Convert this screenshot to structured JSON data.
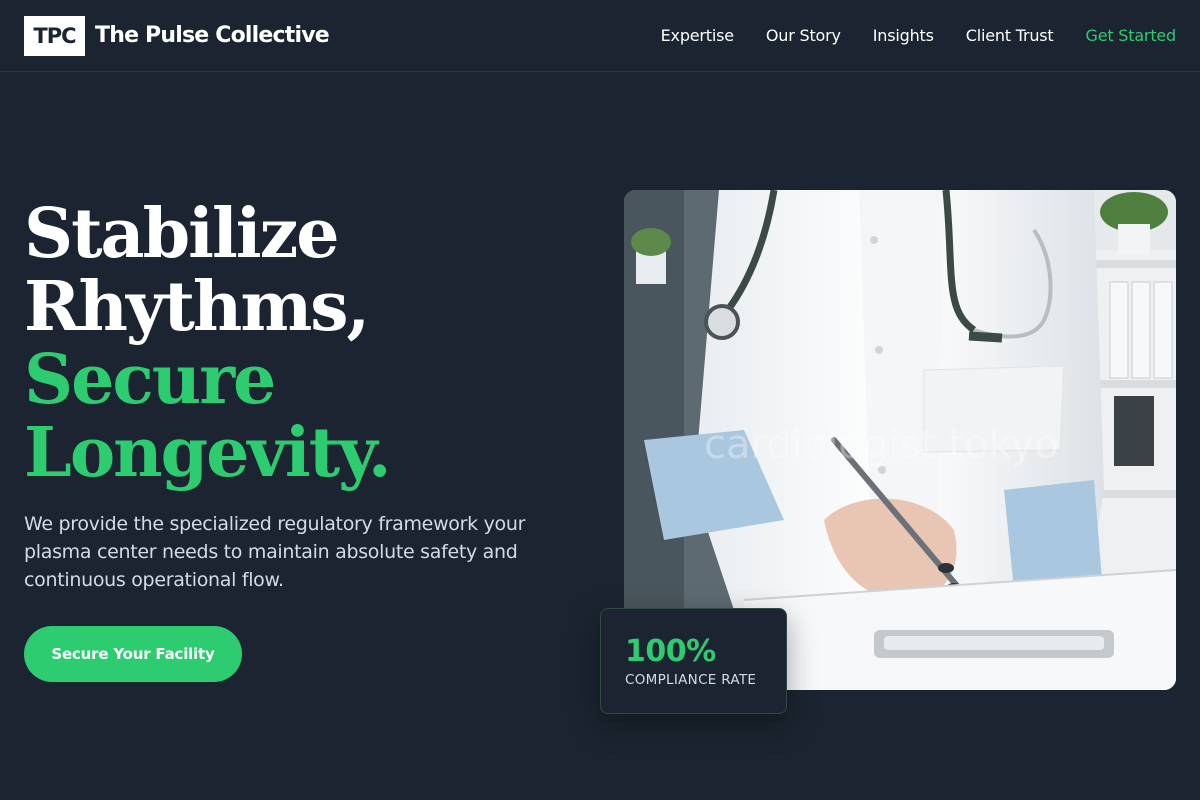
{
  "brand": {
    "logo_text": "TPC",
    "name": "The Pulse Collective"
  },
  "nav": {
    "items": [
      {
        "label": "Expertise"
      },
      {
        "label": "Our Story"
      },
      {
        "label": "Insights"
      },
      {
        "label": "Client Trust"
      },
      {
        "label": "Get Started"
      }
    ]
  },
  "hero": {
    "headline_lines": [
      "Stabilize",
      "Rhythms,",
      "Secure",
      "Longevity."
    ],
    "subtext": "We provide the specialized regulatory framework your plasma center needs to maintain absolute safety and continuous operational flow.",
    "cta_label": "Secure Your Facility"
  },
  "photo": {
    "watermark": "cardiologist tokyo",
    "alt": "cardiologist"
  },
  "stat": {
    "value": "100%",
    "label": "COMPLIANCE RATE"
  },
  "colors": {
    "background": "#1b2430",
    "accent": "#2ecc71",
    "text": "#ffffff",
    "muted_text": "#d5dbe3"
  }
}
